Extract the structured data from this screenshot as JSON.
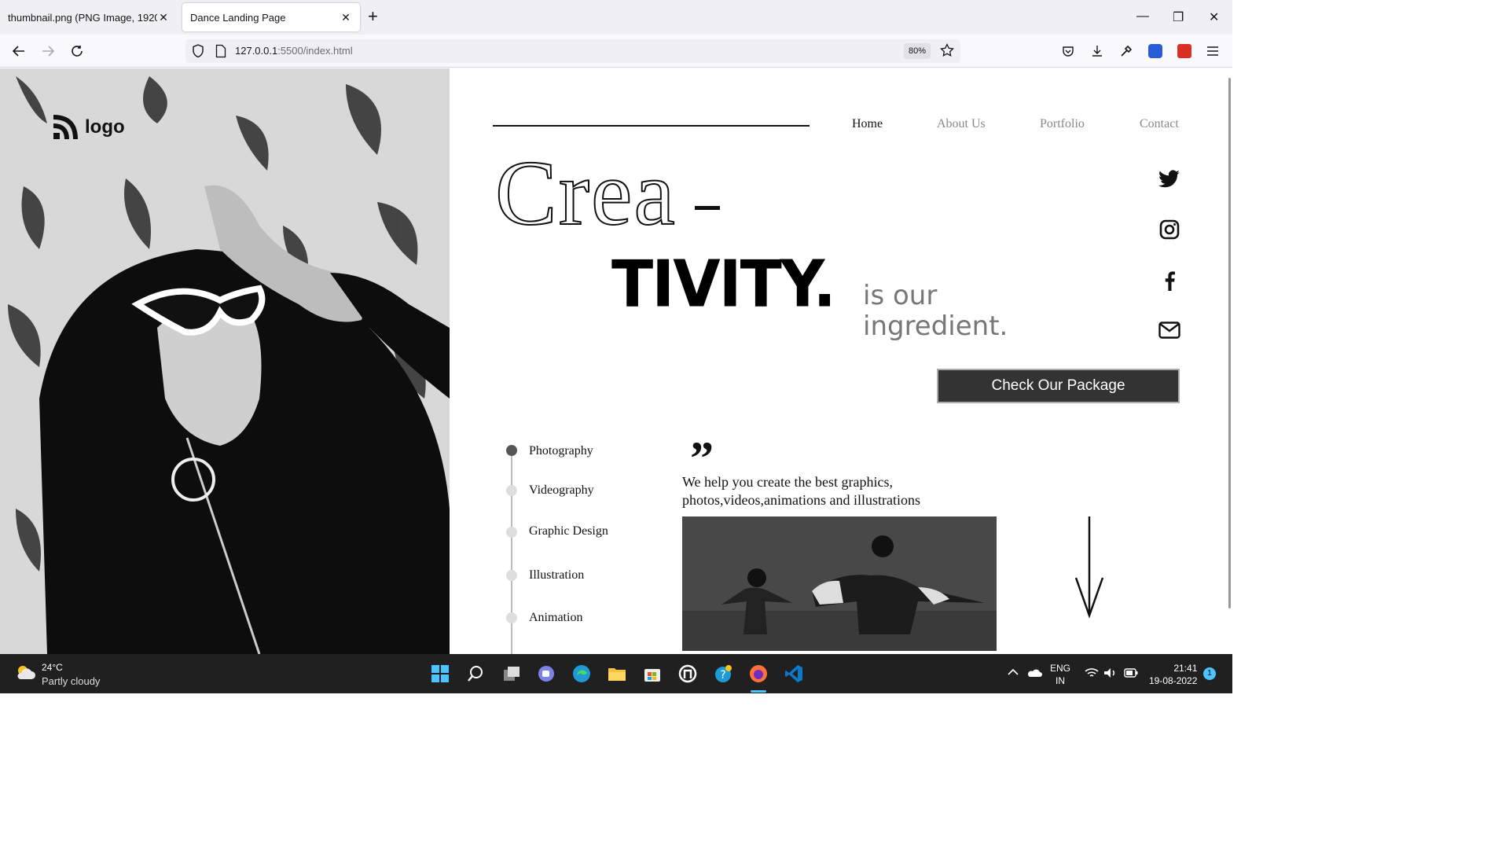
{
  "browser": {
    "tabs": [
      {
        "label": "thumbnail.png (PNG Image, 1920 ×",
        "active": false
      },
      {
        "label": "Dance Landing Page",
        "active": true
      }
    ],
    "url_host": "127.0.0.1",
    "url_path": ":5500/index.html",
    "zoom": "80%"
  },
  "page": {
    "logo_text": "logo",
    "nav": {
      "home": "Home",
      "about": "About Us",
      "portfolio": "Portfolio",
      "contact": "Contact"
    },
    "headline": {
      "part1": "Crea",
      "part2": "TIVITY.",
      "tagline_line1": "is our",
      "tagline_line2": "ingredient."
    },
    "social_icons": [
      "twitter-icon",
      "instagram-icon",
      "facebook-icon",
      "mail-icon"
    ],
    "cta_label": "Check Our Package",
    "services": [
      {
        "label": "Photography",
        "active": true
      },
      {
        "label": "Videography",
        "active": false
      },
      {
        "label": "Graphic Design",
        "active": false
      },
      {
        "label": "Illustration",
        "active": false
      },
      {
        "label": "Animation",
        "active": false
      }
    ],
    "quote_mark": "”",
    "blurb_line1": "We help you create the best graphics,",
    "blurb_line2": "photos,videos,animations and illustrations"
  },
  "taskbar": {
    "weather_temp": "24°C",
    "weather_desc": "Partly cloudy",
    "lang_line1": "ENG",
    "lang_line2": "IN",
    "time": "21:41",
    "date": "19-08-2022",
    "notification_count": "1"
  }
}
